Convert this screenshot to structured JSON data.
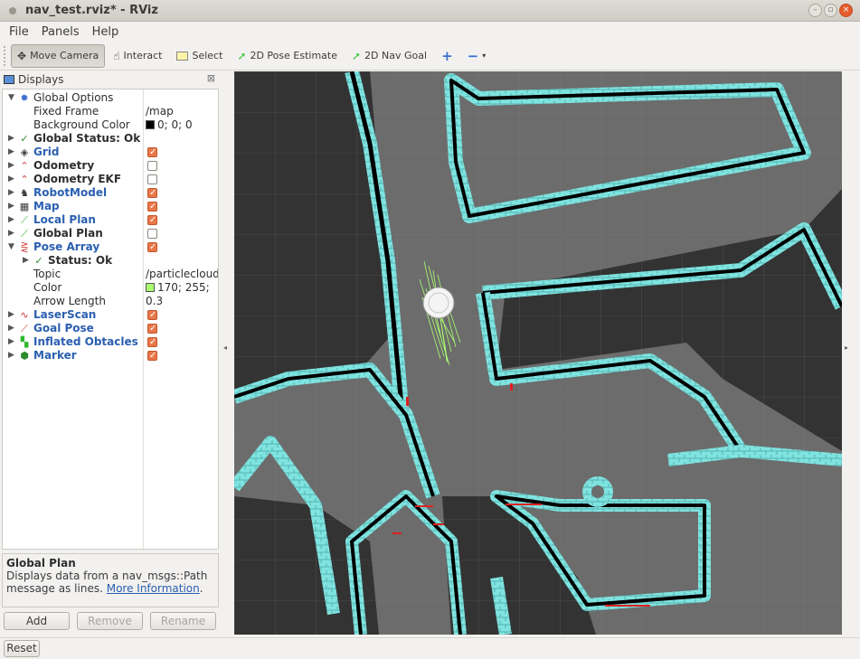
{
  "window": {
    "title": "nav_test.rviz* - RViz"
  },
  "menu": [
    "File",
    "Panels",
    "Help"
  ],
  "toolbar": {
    "move_camera": "Move Camera",
    "interact": "Interact",
    "select": "Select",
    "pose_estimate": "2D Pose Estimate",
    "nav_goal": "2D Nav Goal"
  },
  "panel": {
    "title": "Displays",
    "rows": [
      {
        "label": "Global Options",
        "value": ""
      },
      {
        "label": "Fixed Frame",
        "value": "/map"
      },
      {
        "label": "Background Color",
        "value": "0; 0; 0"
      },
      {
        "label": "Global Status: Ok",
        "value": ""
      },
      {
        "label": "Grid",
        "value": ""
      },
      {
        "label": "Odometry",
        "value": ""
      },
      {
        "label": "Odometry EKF",
        "value": ""
      },
      {
        "label": "RobotModel",
        "value": ""
      },
      {
        "label": "Map",
        "value": ""
      },
      {
        "label": "Local Plan",
        "value": ""
      },
      {
        "label": "Global Plan",
        "value": ""
      },
      {
        "label": "Pose Array",
        "value": ""
      },
      {
        "label": "Status: Ok",
        "value": ""
      },
      {
        "label": "Topic",
        "value": "/particlecloud"
      },
      {
        "label": "Color",
        "value": "170; 255;"
      },
      {
        "label": "Arrow Length",
        "value": "0.3"
      },
      {
        "label": "LaserScan",
        "value": ""
      },
      {
        "label": "Goal Pose",
        "value": ""
      },
      {
        "label": "Inflated Obtacles",
        "value": ""
      },
      {
        "label": "Marker",
        "value": ""
      }
    ],
    "checks": {
      "grid": true,
      "odometry": false,
      "odometry_ekf": false,
      "robotmodel": true,
      "map": true,
      "local_plan": true,
      "global_plan": false,
      "pose_array": true,
      "laserscan": true,
      "goal_pose": true,
      "inflated": true,
      "marker": true
    }
  },
  "help": {
    "title": "Global Plan",
    "text": "Displays data from a nav_msgs::Path message as lines.",
    "link": "More Information"
  },
  "buttons": {
    "add": "Add",
    "remove": "Remove",
    "rename": "Rename",
    "reset": "Reset"
  },
  "colors": {
    "map_free": "#6e6e6e",
    "inflation": "#7fe3e0",
    "particles": "#aaff6e",
    "accent_check": "#e9774a",
    "link": "#2a5fb0"
  }
}
